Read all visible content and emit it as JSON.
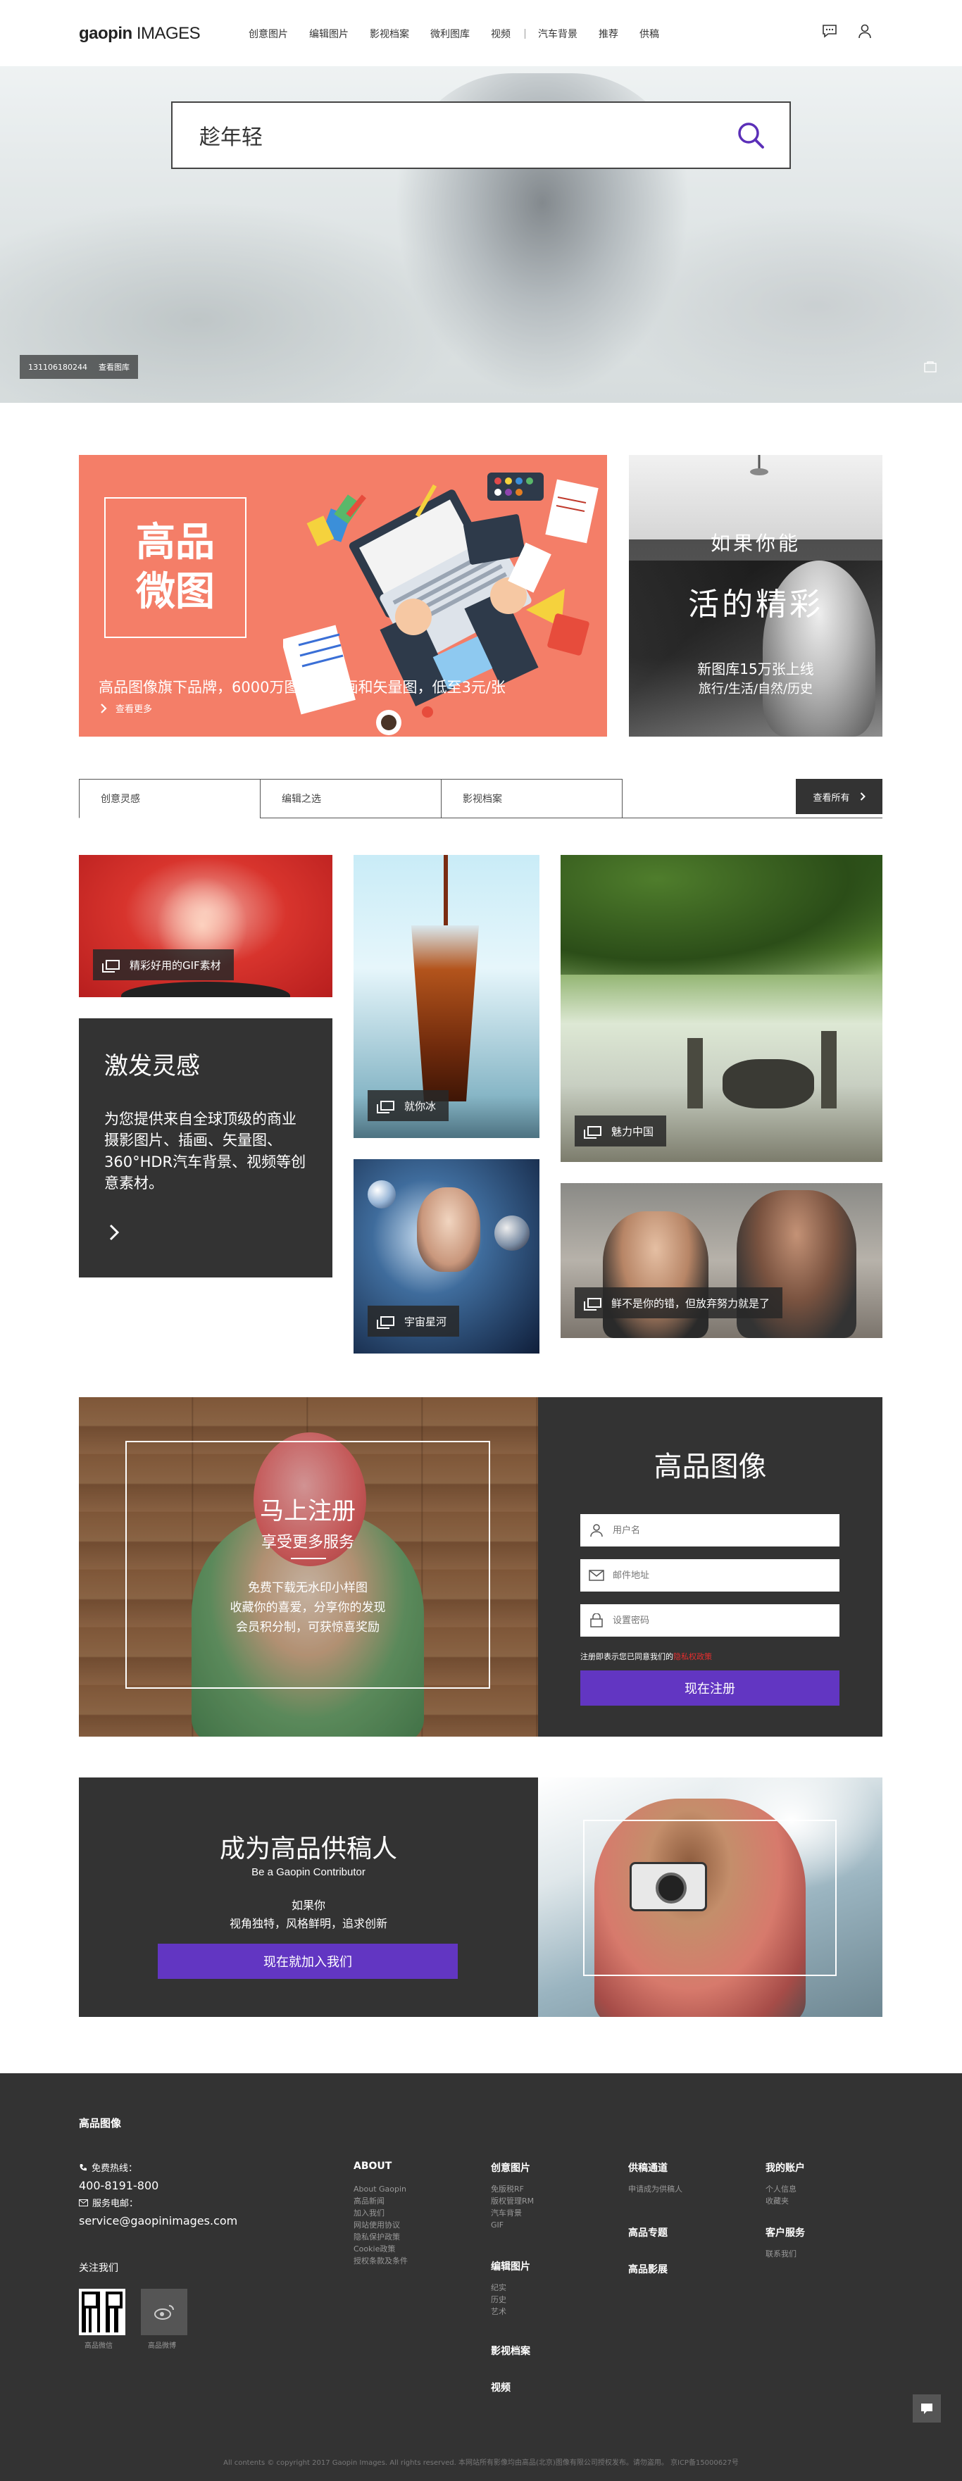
{
  "header": {
    "logo_brand": "gaopin",
    "logo_suffix": " IMAGES",
    "nav": [
      "创意图片",
      "编辑图片",
      "影视档案",
      "微利图库",
      "视频",
      "汽车背景",
      "推荐",
      "供稿"
    ]
  },
  "hero": {
    "search_value": "趁年轻",
    "photo_id": "131106180244",
    "photo_tag": "查看图库"
  },
  "promo": {
    "box_line1": "高品",
    "box_line2": "微图",
    "desc": "高品图像旗下品牌，6000万图片，插画和矢量图，低至3元/张",
    "more": "查看更多",
    "right_t1": "如果你能",
    "right_t2": "活的精彩",
    "right_t3": "新图库15万张上线",
    "right_t4": "旅行/生活/自然/历史"
  },
  "tabs": {
    "items": [
      "创意灵感",
      "编辑之选",
      "影视档案"
    ],
    "view_all": "查看所有"
  },
  "gallery": {
    "gif_caption": "精彩好用的GIF素材",
    "cola_caption": "就你冰",
    "universe_caption": "宇宙星河",
    "china_caption": "魅力中国",
    "fitness_caption": "鲜不是你的错，但放弃努力就是了",
    "inspire_title": "激发灵感",
    "inspire_text": "为您提供来自全球顶级的商业摄影图片、插画、矢量图、360°HDR汽车背景、视频等创意素材。"
  },
  "register": {
    "left_title": "马上注册",
    "left_sub": "享受更多服务",
    "left_lines": [
      "免费下载无水印小样图",
      "收藏你的喜爱，分享你的发现",
      "会员积分制，可获惊喜奖励"
    ],
    "title": "高品图像",
    "username_placeholder": "用户名",
    "email_placeholder": "邮件地址",
    "password_placeholder": "设置密码",
    "agree_text": "注册即表示您已同意我们的",
    "agree_link": "隐私权政策",
    "button": "现在注册"
  },
  "contributor": {
    "title": "成为高品供稿人",
    "subtitle": "Be a Gaopin Contributor",
    "line1": "如果你",
    "line2": "视角独特，风格鲜明，追求创新",
    "button": "现在就加入我们"
  },
  "footer": {
    "brand": "高品图像",
    "hotline_label": "免费热线：",
    "hotline": "400-8191-800",
    "email_label": "服务电邮：",
    "email": "service@gaopinimages.com",
    "follow": "关注我们",
    "qr_label": "高品微信",
    "weibo_label": "高品微博",
    "col_about": {
      "head": "ABOUT",
      "links": [
        "About Gaopin",
        "高品新闻",
        "加入我们",
        "网站使用协议",
        "隐私保护政策",
        "Cookie政策",
        "授权条款及条件"
      ]
    },
    "col_creative": {
      "head": "创意图片",
      "links": [
        "免版税RF",
        "版权管理RM",
        "汽车背景",
        "GIF"
      ]
    },
    "col_editorial": {
      "head": "编辑图片",
      "links": [
        "纪实",
        "历史",
        "艺术"
      ]
    },
    "col_film": "影视档案",
    "col_video": "视频",
    "col_supply": {
      "head": "供稿通道",
      "links": [
        "申请成为供稿人"
      ]
    },
    "col_special": "高品专题",
    "col_film2": "高品影展",
    "col_account": {
      "head": "我的账户",
      "links": [
        "个人信息",
        "收藏夹"
      ]
    },
    "col_service": {
      "head": "客户服务",
      "links": [
        "联系我们"
      ]
    },
    "copyright": "All contents © copyright 2017 Gaopin Images. All rights reserved. 本网站所有影像均由高品(北京)图像有限公司授权发布。请勿盗用。 京ICP备15000627号"
  }
}
